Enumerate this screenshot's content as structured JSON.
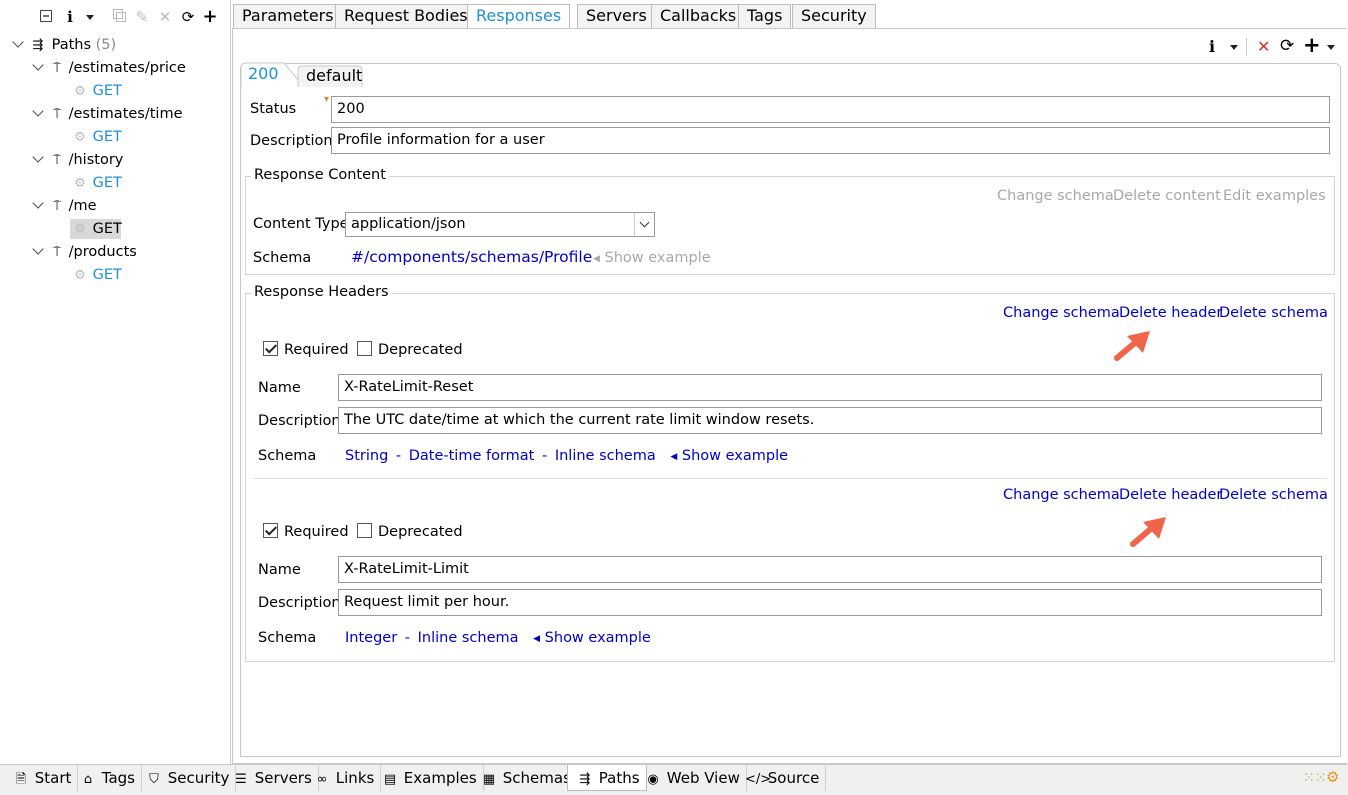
{
  "tree": {
    "toolbar": [
      "collapse-icon",
      "info-icon",
      "dropdown-icon",
      "copy-icon",
      "edit-icon",
      "delete-icon",
      "refresh-icon",
      "add-icon"
    ],
    "root_label": "Paths",
    "root_count": "(5)",
    "paths": [
      {
        "name": "/estimates/price",
        "method": "GET"
      },
      {
        "name": "/estimates/time",
        "method": "GET"
      },
      {
        "name": "/history",
        "method": "GET"
      },
      {
        "name": "/me",
        "method": "GET"
      },
      {
        "name": "/products",
        "method": "GET"
      }
    ]
  },
  "top_tabs": [
    "Parameters",
    "Request Bodies",
    "Responses",
    "Servers",
    "Callbacks",
    "Tags",
    "Security"
  ],
  "active_tab": "Responses",
  "response_tabs": [
    "200",
    "default"
  ],
  "response": {
    "status_label": "Status",
    "status_value": "200",
    "description_label": "Description",
    "description_value": "Profile information for a user"
  },
  "content": {
    "title": "Response Content",
    "actions": [
      "Change schema",
      "Delete content",
      "Edit examples"
    ],
    "content_type_label": "Content Type",
    "content_type_value": "application/json",
    "schema_label": "Schema",
    "schema_value": "#/components/schemas/Profile",
    "show_example": "Show example"
  },
  "headers": {
    "title": "Response Headers",
    "items": [
      {
        "actions": [
          "Change schema",
          "Delete header",
          "Delete schema"
        ],
        "required_label": "Required",
        "deprecated_label": "Deprecated",
        "name_label": "Name",
        "name_value": "X-RateLimit-Reset",
        "description_label": "Description",
        "description_value": "The UTC date/time at which the current rate limit window resets.",
        "schema_label": "Schema",
        "schema_parts": [
          "String",
          "-",
          "Date-time format",
          "-",
          "Inline schema"
        ],
        "show_example": "Show example"
      },
      {
        "actions": [
          "Change schema",
          "Delete header",
          "Delete schema"
        ],
        "required_label": "Required",
        "deprecated_label": "Deprecated",
        "name_label": "Name",
        "name_value": "X-RateLimit-Limit",
        "description_label": "Description",
        "description_value": "Request limit per hour.",
        "schema_label": "Schema",
        "schema_parts": [
          "Integer",
          "-",
          "Inline schema"
        ],
        "show_example": "Show example"
      }
    ]
  },
  "bottom_tabs": [
    "Start",
    "Tags",
    "Security",
    "Servers",
    "Links",
    "Examples",
    "Schemas",
    "Paths",
    "Web View",
    "Source"
  ],
  "active_bottom_tab": "Paths",
  "colors": {
    "link": "#0000cc",
    "accent": "#1e90d8",
    "arrow": "#f0654a",
    "disabled": "#a8a8a8"
  }
}
